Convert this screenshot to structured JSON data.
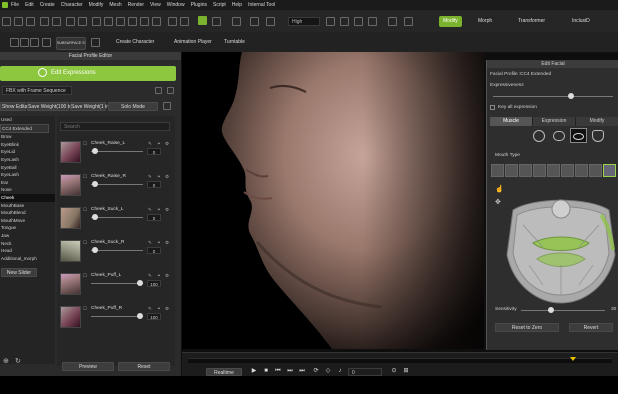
{
  "menubar": {
    "items": [
      "File",
      "Edit",
      "Create",
      "Character",
      "Modify",
      "Mesh",
      "Render",
      "View",
      "Window",
      "Plugins",
      "Script",
      "Help",
      "Internal Tool"
    ]
  },
  "toolbar": {
    "quality": "High",
    "modify": "Modify",
    "morph": "Morph",
    "transformer": "Transformer",
    "inclus": "InclusiD",
    "subsurface": "SUBSURFACE SCATTERING",
    "create_character": "Create Character",
    "animation_player": "Animation Player",
    "turntable": "Turntable"
  },
  "left_panel": {
    "title": "Facial Profile Editor",
    "edit_expressions": "Edit Expressions",
    "preset_dropdown": "FBX with Frame Sequence",
    "show_editability": "Show Editability",
    "save_weight_100": "Save Weight(100 to)",
    "save_weight_1": "Save Weight(1 ini)",
    "solo_mode": "Solo Mode",
    "used_label": "Used",
    "category_list": [
      "CC4 Extended",
      "Brow",
      "EyeBlink",
      "EyeLid",
      "EyeLash",
      "EyeBall",
      "EyeLash",
      "Ear",
      "Nose",
      "Cheek",
      "MouthBase",
      "MouthBlend",
      "MouthMove",
      "Tongue",
      "Jaw",
      "Neck",
      "Head",
      "Additional_morph"
    ],
    "selected_category": "Cheek",
    "new_slider": "New Slider",
    "search_placeholder": "Search",
    "sliders": [
      {
        "name": "Cheek_Raise_L",
        "value": "0"
      },
      {
        "name": "Cheek_Raise_R",
        "value": "0"
      },
      {
        "name": "Cheek_Suck_L",
        "value": "0"
      },
      {
        "name": "Cheek_Suck_R",
        "value": "0"
      },
      {
        "name": "Cheek_Puff_L",
        "value": "100"
      },
      {
        "name": "Cheek_Puff_R",
        "value": "100"
      }
    ],
    "preview": "Preview",
    "reset": "Reset"
  },
  "right_panel": {
    "title": "Edit Facial",
    "facial_profile_label": "Facial Profile :",
    "facial_profile_value": "CC4 Extended",
    "expressiveness": "Expressiveness",
    "key_all": "Key all expression",
    "tabs": [
      "Muscle",
      "Expression",
      "Modify"
    ],
    "active_tab": "Muscle",
    "mouth_type": "Mouth Type",
    "sensitivity": "Sensitivity",
    "sensitivity_value": "30",
    "reset_to_zero": "Reset to Zero",
    "revert": "Revert"
  },
  "timeline": {
    "realtime": "Realtime",
    "frame": "0"
  },
  "sliders_levels": {
    "raise_l": 0,
    "raise_r": 0,
    "suck_l": 0,
    "suck_r": 0,
    "puff_l": 1,
    "puff_r": 1
  },
  "colors": {
    "accent_green": "#8dc63f",
    "panel_bg": "#2b2b2b"
  }
}
